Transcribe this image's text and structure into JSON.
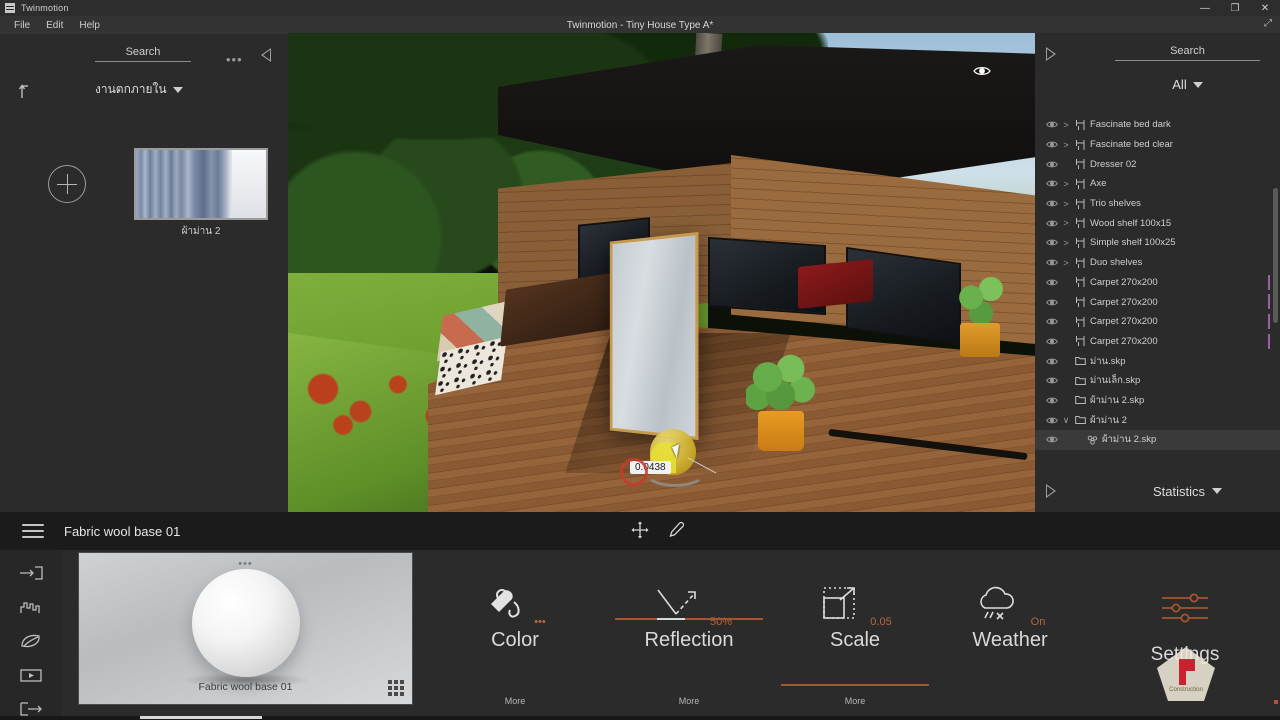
{
  "window": {
    "app_name": "Twinmotion",
    "document_title": "Twinmotion - Tiny House Type A*",
    "minimize": "—",
    "maximize": "❐",
    "close": "✕",
    "restore_glyph": "⤢"
  },
  "menu": {
    "items": [
      {
        "label": "File"
      },
      {
        "label": "Edit"
      },
      {
        "label": "Help"
      }
    ]
  },
  "library_panel": {
    "search_label": "Search",
    "more_dots": "•••",
    "category": "งานตกภายใน",
    "asset": {
      "caption": "ผ้าม่าน 2"
    }
  },
  "viewport": {
    "gizmo_value": "0.0438"
  },
  "outliner": {
    "search_label": "Search",
    "filter_label": "All",
    "rows": [
      {
        "label": "Fascinate bed dark",
        "expandable": true,
        "icon": "object-icon",
        "selected": false,
        "material_strip": false
      },
      {
        "label": "Fascinate bed clear",
        "expandable": true,
        "icon": "object-icon",
        "selected": false,
        "material_strip": false
      },
      {
        "label": "Dresser 02",
        "expandable": false,
        "icon": "object-icon",
        "selected": false,
        "material_strip": false
      },
      {
        "label": "Axe",
        "expandable": true,
        "icon": "object-icon",
        "selected": false,
        "material_strip": false
      },
      {
        "label": "Trio shelves",
        "expandable": true,
        "icon": "object-icon",
        "selected": false,
        "material_strip": false
      },
      {
        "label": "Wood shelf 100x15",
        "expandable": true,
        "icon": "object-icon",
        "selected": false,
        "material_strip": false
      },
      {
        "label": "Simple shelf 100x25",
        "expandable": true,
        "icon": "object-icon",
        "selected": false,
        "material_strip": false
      },
      {
        "label": "Duo shelves",
        "expandable": true,
        "icon": "object-icon",
        "selected": false,
        "material_strip": false
      },
      {
        "label": "Carpet 270x200",
        "expandable": false,
        "icon": "object-icon",
        "selected": false,
        "material_strip": true
      },
      {
        "label": "Carpet 270x200",
        "expandable": false,
        "icon": "object-icon",
        "selected": false,
        "material_strip": true
      },
      {
        "label": "Carpet 270x200",
        "expandable": false,
        "icon": "object-icon",
        "selected": false,
        "material_strip": true
      },
      {
        "label": "Carpet 270x200",
        "expandable": false,
        "icon": "object-icon",
        "selected": false,
        "material_strip": true
      },
      {
        "label": "ม่าน.skp",
        "expandable": false,
        "icon": "folder-icon",
        "selected": false,
        "material_strip": false
      },
      {
        "label": "ม่านเล็ก.skp",
        "expandable": false,
        "icon": "folder-icon",
        "selected": false,
        "material_strip": false
      },
      {
        "label": "ผ้าม่าน 2.skp",
        "expandable": false,
        "icon": "folder-icon",
        "selected": false,
        "material_strip": false
      },
      {
        "label": "ผ้าม่าน 2",
        "expandable": true,
        "expanded": true,
        "icon": "folder-icon",
        "selected": false,
        "material_strip": false
      },
      {
        "label": "ผ้าม่าน 2.skp",
        "expandable": false,
        "icon": "mesh-icon",
        "indent": true,
        "selected": true,
        "material_strip": false
      }
    ]
  },
  "statistics": {
    "label": "Statistics"
  },
  "material_dock": {
    "title": "Fabric wool base 01",
    "preview_caption": "Fabric wool base 01",
    "preview_dots": "•••",
    "rail_icons": [
      {
        "name": "import-icon"
      },
      {
        "name": "urban-icon"
      },
      {
        "name": "vegetation-icon"
      },
      {
        "name": "media-icon"
      },
      {
        "name": "export-icon"
      }
    ],
    "tools": [
      {
        "name": "move-gizmo-icon"
      },
      {
        "name": "eyedropper-icon"
      }
    ],
    "properties": [
      {
        "title": "Color",
        "value": "•••",
        "more": "More",
        "slider": false,
        "slider_fill": 0
      },
      {
        "title": "Reflection",
        "value": "50%",
        "more": "More",
        "slider": true,
        "slider_fill": 50
      },
      {
        "title": "Scale",
        "value": "0.05",
        "more": "More",
        "slider": true,
        "slider_fill": 100
      },
      {
        "title": "Weather",
        "value": "On",
        "more": "",
        "slider": false,
        "slider_fill": 0
      }
    ],
    "settings_label": "Settings"
  },
  "colors": {
    "accent": "#b4683c",
    "panel_bg": "#2b2b2b",
    "dock_header_bg": "#1b1b1b",
    "titlebar_bg": "#2d2d2d",
    "menubar_bg": "#333333",
    "text": "#d8d8d8",
    "selection": "#3a3a3a",
    "material_strip": "#9b5fa8"
  }
}
